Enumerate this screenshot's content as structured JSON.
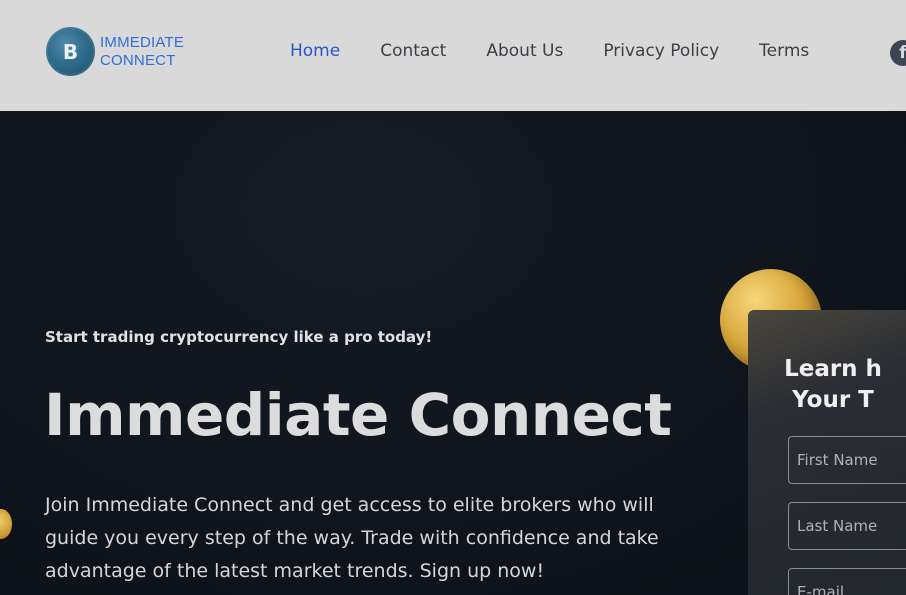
{
  "header": {
    "logo_line1": "IMMEDIATE",
    "logo_line2": "CONNECT",
    "logo_symbol": "B",
    "nav": {
      "home": "Home",
      "contact": "Contact",
      "about": "About Us",
      "privacy": "Privacy Policy",
      "terms": "Terms"
    },
    "social_icon": "facebook-icon"
  },
  "hero": {
    "tagline": "Start trading cryptocurrency like a pro today!",
    "title": "Immediate Connect",
    "description": "Join Immediate Connect and get access to elite brokers who will guide you every step of the way. Trade with confidence and take advantage of the latest market trends. Sign up now!"
  },
  "form": {
    "title_line1": "Learn h",
    "title_line2": "Your T",
    "first_name_placeholder": "First Name",
    "last_name_placeholder": "Last Name",
    "email_placeholder": "E-mail"
  },
  "colors": {
    "header_bg": "#d9d9d9",
    "nav_active": "#2b56c6",
    "brand": "#2f6fd6",
    "hero_bg": "#0f141c",
    "coin_gold": "#d9a93e"
  }
}
